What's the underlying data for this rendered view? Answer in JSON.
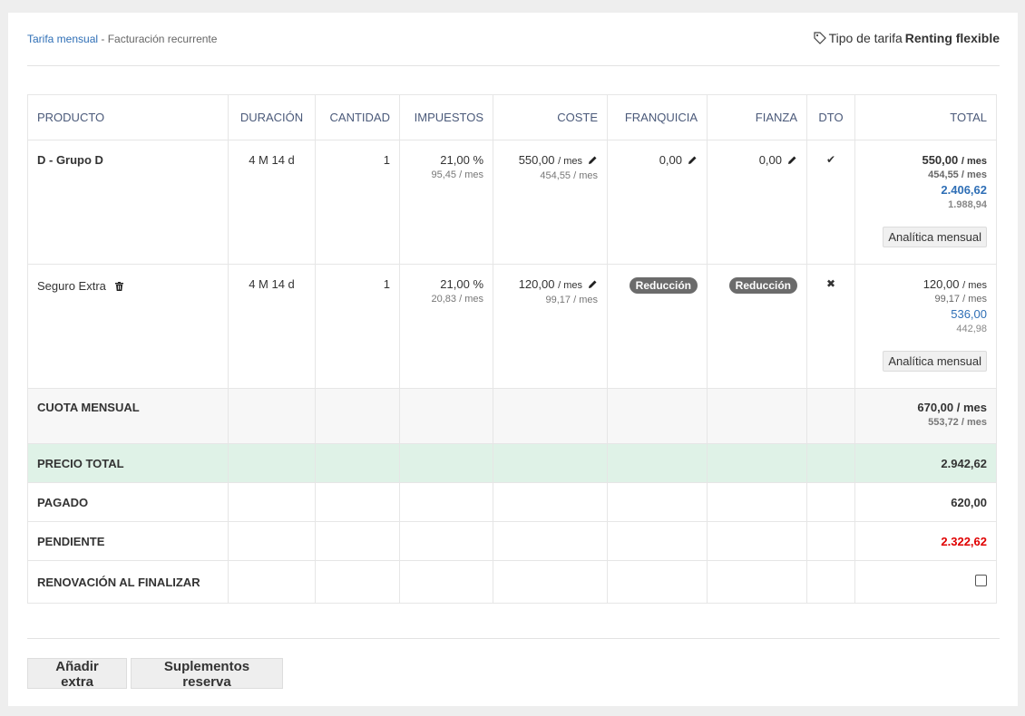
{
  "header": {
    "breadcrumb_link": "Tarifa mensual",
    "breadcrumb_sep": " - ",
    "breadcrumb_rest": "Facturación recurrente",
    "tarifa_label": "Tipo de tarifa",
    "tarifa_value": "Renting flexible"
  },
  "columns": [
    "PRODUCTO",
    "DURACIÓN",
    "CANTIDAD",
    "IMPUESTOS",
    "COSTE",
    "FRANQUICIA",
    "FIANZA",
    "DTO",
    "TOTAL"
  ],
  "rows": [
    {
      "producto": "D - Grupo D",
      "duracion": "4 M 14 d",
      "cantidad": "1",
      "impuestos": "21,00 %",
      "impuestos_sub": "95,45 / mes",
      "coste": "550,00",
      "coste_unit": "/ mes",
      "coste_sub": "454,55 / mes",
      "franquicia": "0,00",
      "fianza": "0,00",
      "dto": "✔",
      "total1": "550,00",
      "total1_unit": "/ mes",
      "total2": "454,55 / mes",
      "total3": "2.406,62",
      "total4": "1.988,94",
      "analitica": "Analítica mensual"
    },
    {
      "producto": "Seguro Extra",
      "duracion": "4 M 14 d",
      "cantidad": "1",
      "impuestos": "21,00 %",
      "impuestos_sub": "20,83 / mes",
      "coste": "120,00",
      "coste_unit": "/ mes",
      "coste_sub": "99,17 / mes",
      "franquicia": "Reducción",
      "fianza": "Reducción",
      "dto": "✖",
      "total1": "120,00",
      "total1_unit": "/ mes",
      "total2": "99,17 / mes",
      "total3": "536,00",
      "total4": "442,98",
      "analitica": "Analítica mensual"
    }
  ],
  "summary": {
    "cuota_label": "CUOTA MENSUAL",
    "cuota_value": "670,00 / mes",
    "cuota_sub": "553,72 / mes",
    "precio_label": "PRECIO TOTAL",
    "precio_value": "2.942,62",
    "pagado_label": "PAGADO",
    "pagado_value": "620,00",
    "pendiente_label": "PENDIENTE",
    "pendiente_value": "2.322,62",
    "renovacion_label": "RENOVACIÓN AL FINALIZAR"
  },
  "footer": {
    "add_extra": "Añadir extra",
    "suplementos": "Suplementos reserva"
  },
  "colors": {
    "link": "#2f6fb6",
    "pending": "#e00000",
    "precio_bg": "#dff2e7",
    "badge_bg": "#6b6b6b"
  }
}
